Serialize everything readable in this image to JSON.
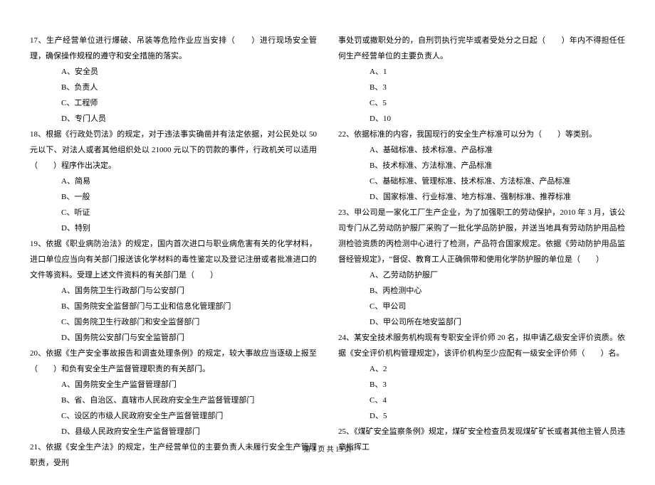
{
  "left_column": {
    "q17": {
      "text": "17、生产经营单位进行爆破、吊装等危险作业应当安排（　　）进行现场安全管理，确保操作规程的遵守和安全措施的落实。",
      "options": [
        "A、安全员",
        "B、负责人",
        "C、工程师",
        "D、专门人员"
      ]
    },
    "q18": {
      "text": "18、根据《行政处罚法》的规定，对于违法事实确凿并有法定依据，对公民处以 50 元以下、对法人或者其他组织处以 21000 元以下的罚款的事件，行政机关可以适用（　　）程序作出决定。",
      "options": [
        "A、简易",
        "B、一般",
        "C、听证",
        "D、特别"
      ]
    },
    "q19": {
      "text": "19、依据《职业病防治法》的规定，国内首次进口与职业病危害有关的化学材料，进口单位应当向有关部门报送该化学材料的毒性鉴定以及登记注册或者批准进口的文件等资料。受理上述文件资料的有关部门是（　　）",
      "options": [
        "A、国务院卫生行政部门与公安部门",
        "B、国务院安全监督部门与工业和信息化管理部门",
        "C、国务院卫生行政部门和安全监督部门",
        "D、国务院公安部门与安全监管部门"
      ]
    },
    "q20": {
      "text": "20、依据《生产安全事故报告和调查处理条例》的规定，较大事故应当逐级上报至（　　）和负有安全生产监督管理职责的有关部门。",
      "options": [
        "A、国务院安全生产监督管理部门",
        "B、省、自治区、直辖市人民政府安全生产监督管理部门",
        "C、设区的市级人民政府安全生产监督管理部门",
        "D、县级人民政府安全生产监督管理部门"
      ]
    },
    "q21": {
      "text": "21、依据《安全生产法》的规定，生产经营单位的主要负责人未履行安全生产管理职责，受刑"
    }
  },
  "right_column": {
    "q21_cont": {
      "text": "事处罚或撤职处分的，自刑罚执行完毕或者受处分之日起（　　）年内不得担任任何生产经营单位的主要负责人。",
      "options": [
        "A、1",
        "B、3",
        "C、5",
        "D、10"
      ]
    },
    "q22": {
      "text": "22、依据标准的内容，我国现行的安全生产标准可以分为（　　）等类别。",
      "options": [
        "A、基础标准、技术标准、产品标准",
        "B、技术标准、方法标准、产品标准",
        "C、基础标准、管理标准、技术标准、方法标准、产品标准",
        "D、国家标准、行业标准、地方标准、强制标准、推荐标准"
      ]
    },
    "q23": {
      "text": "23、甲公司是一家化工厂生产企业，为了加强职工的劳动保护，2010 年 3 月，该公司专门从乙劳动防护服厂采购了一批化学品防护服，并送当地具有劳动防护用品检测检验资质的丙检测中心进行了检测，产品符合国家规定。依据《劳动防护用品监督经管规定》，\"督促、教育工人正确佩带和使用化学防护服的单位是（　　）",
      "options": [
        "A、乙劳动防护服厂",
        "B、丙检测中心",
        "C、甲公司",
        "D、甲公司所在地安监部门"
      ]
    },
    "q24": {
      "text": "24、某安全技术服务机构现有专职安全评价师 20 名，拟申请乙级安全评价资质。依据《安全评价机构管理规定》，该评价机构至少应配有一级安全评价师（　　）名。",
      "options": [
        "A、2",
        "B、3",
        "C、4",
        "D、5"
      ]
    },
    "q25": {
      "text": "25、《煤矿安全监察条例》规定，煤矿安全检查员发现煤矿矿长或者其他主管人员违章指挥工"
    }
  },
  "footer": "第 3 页 共 13 页"
}
